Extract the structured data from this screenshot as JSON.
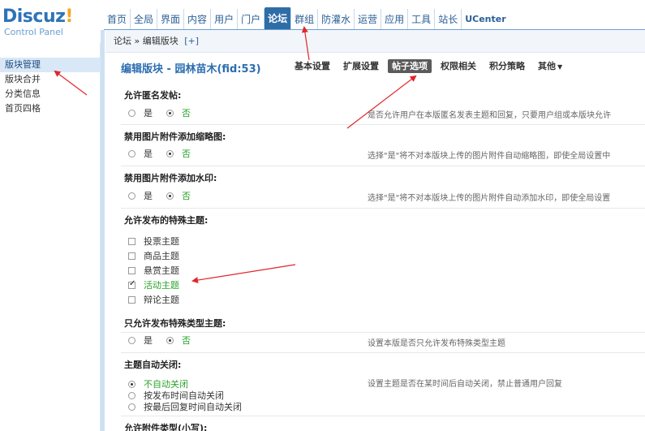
{
  "logo": {
    "main": "Discuz",
    "bang": "!",
    "sub": "Control Panel"
  },
  "topnav": [
    "首页",
    "全局",
    "界面",
    "内容",
    "用户",
    "门户",
    "论坛",
    "群组",
    "防灌水",
    "运营",
    "应用",
    "工具",
    "站长",
    "UCenter"
  ],
  "topnav_active": "论坛",
  "sidebar": {
    "items": [
      "版块管理",
      "版块合并",
      "分类信息",
      "首页四格"
    ],
    "active": "版块管理"
  },
  "breadcrumb": {
    "root": "论坛",
    "sep": "»",
    "current": "编辑版块",
    "add": "[+]"
  },
  "page_title": "编辑版块 - 园林苗木(fid:53)",
  "tabs": [
    "基本设置",
    "扩展设置",
    "帖子选项",
    "权限相关",
    "积分策略",
    "其他"
  ],
  "tab_active": "帖子选项",
  "tab_more_caret": "▼",
  "sections": {
    "anon": {
      "label": "允许匿名发帖:",
      "hint": "是否允许用户在本版匿名发表主题和回复，只要用户组或本版块允许",
      "yes": "是",
      "no": "否"
    },
    "thumb": {
      "label": "禁用图片附件添加缩略图:",
      "hint": "选择\"是\"将不对本版块上传的图片附件自动缩略图，即使全局设置中",
      "yes": "是",
      "no": "否"
    },
    "watermark": {
      "label": "禁用图片附件添加水印:",
      "hint": "选择\"是\"将不对本版块上传的图片附件自动添加水印，即使全局设置",
      "yes": "是",
      "no": "否"
    },
    "special": {
      "label": "允许发布的特殊主题:",
      "items": [
        "投票主题",
        "商品主题",
        "悬赏主题",
        "活动主题",
        "辩论主题"
      ]
    },
    "only_special": {
      "label": "只允许发布特殊类型主题:",
      "hint": "设置本版是否只允许发布特殊类型主题",
      "yes": "是",
      "no": "否"
    },
    "autoclose": {
      "label": "主题自动关闭:",
      "hint": "设置主题是否在某时间后自动关闭，禁止普通用户回复",
      "options": [
        "不自动关闭",
        "按发布时间自动关闭",
        "按最后回复时间自动关闭"
      ]
    },
    "attach": {
      "label": "允许附件类型(小写):"
    }
  },
  "colors": {
    "nav_active": "#2f6da7",
    "title": "#2b6db0",
    "checked_text": "#2aa32a",
    "arrow": "#e0262a"
  }
}
